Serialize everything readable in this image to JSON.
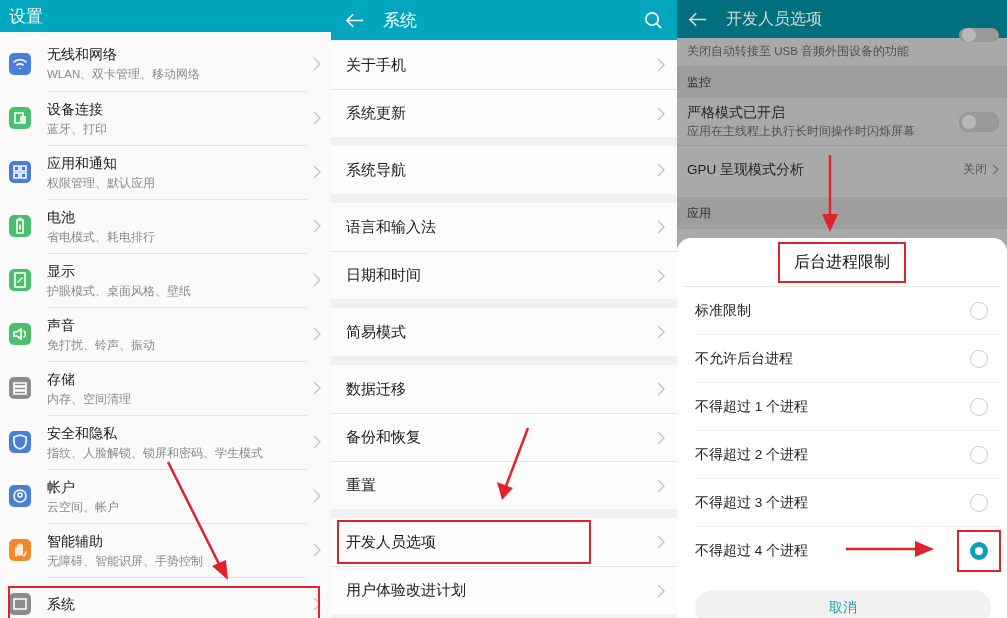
{
  "settings": {
    "title": "设置",
    "items": [
      {
        "title": "无线和网络",
        "subtitle": "WLAN、双卡管理、移动网络",
        "color": "#4a7fd9",
        "highlighted": false
      },
      {
        "title": "设备连接",
        "subtitle": "蓝牙、打印",
        "color": "#4cbf6e",
        "highlighted": false
      },
      {
        "title": "应用和通知",
        "subtitle": "权限管理、默认应用",
        "color": "#4a7fd9",
        "highlighted": false
      },
      {
        "title": "电池",
        "subtitle": "省电模式、耗电排行",
        "color": "#4cbf6e",
        "highlighted": false
      },
      {
        "title": "显示",
        "subtitle": "护眼模式、桌面风格、壁纸",
        "color": "#4cbf6e",
        "highlighted": false
      },
      {
        "title": "声音",
        "subtitle": "免打扰、铃声、振动",
        "color": "#4cbf6e",
        "highlighted": false
      },
      {
        "title": "存储",
        "subtitle": "内存、空间清理",
        "color": "#8c8c8c",
        "highlighted": false
      },
      {
        "title": "安全和隐私",
        "subtitle": "指纹、人脸解锁、锁屏和密码、学生模式",
        "color": "#4a7fd9",
        "highlighted": false
      },
      {
        "title": "帐户",
        "subtitle": "云空间、帐户",
        "color": "#4a7fd9",
        "highlighted": false
      },
      {
        "title": "智能辅助",
        "subtitle": "无障碍、智能识屏、手势控制",
        "color": "#f08a2c",
        "highlighted": false
      },
      {
        "title": "系统",
        "color": "#8c8c8c",
        "highlighted": true
      }
    ]
  },
  "system": {
    "title": "系统",
    "groups": [
      {
        "items": [
          {
            "label": "关于手机",
            "highlighted": false
          },
          {
            "label": "系统更新",
            "highlighted": false
          }
        ]
      },
      {
        "items": [
          {
            "label": "系统导航",
            "highlighted": false
          }
        ]
      },
      {
        "items": [
          {
            "label": "语言和输入法",
            "highlighted": false
          },
          {
            "label": "日期和时间",
            "highlighted": false
          }
        ]
      },
      {
        "items": [
          {
            "label": "简易模式",
            "highlighted": false
          }
        ]
      },
      {
        "items": [
          {
            "label": "数据迁移",
            "highlighted": false
          },
          {
            "label": "备份和恢复",
            "highlighted": false
          },
          {
            "label": "重置",
            "highlighted": false
          }
        ]
      },
      {
        "items": [
          {
            "label": "开发人员选项",
            "highlighted": true
          },
          {
            "label": "用户体验改进计划",
            "highlighted": false
          }
        ]
      }
    ]
  },
  "developer": {
    "title": "开发人员选项",
    "rows": [
      {
        "kind": "note",
        "text": "关闭自动转接至 USB 音频外围设备的功能",
        "on": false
      },
      {
        "kind": "section",
        "text": "监控"
      },
      {
        "kind": "toggle",
        "title": "严格模式已开启",
        "subtitle": "应用在主线程上执行长时间操作时闪烁屏幕",
        "on": false
      },
      {
        "kind": "value",
        "title": "GPU 呈现模式分析",
        "value": "关闭"
      },
      {
        "kind": "section",
        "text": "应用"
      }
    ],
    "dialog": {
      "title": "后台进程限制",
      "title_highlighted": true,
      "options": [
        {
          "label": "标准限制",
          "selected": false,
          "highlighted": false
        },
        {
          "label": "不允许后台进程",
          "selected": false,
          "highlighted": false
        },
        {
          "label": "不得超过 1 个进程",
          "selected": false,
          "highlighted": false
        },
        {
          "label": "不得超过 2 个进程",
          "selected": false,
          "highlighted": false
        },
        {
          "label": "不得超过 3 个进程",
          "selected": false,
          "highlighted": false
        },
        {
          "label": "不得超过 4 个进程",
          "selected": true,
          "highlighted": true
        }
      ],
      "cancel": "取消"
    }
  }
}
